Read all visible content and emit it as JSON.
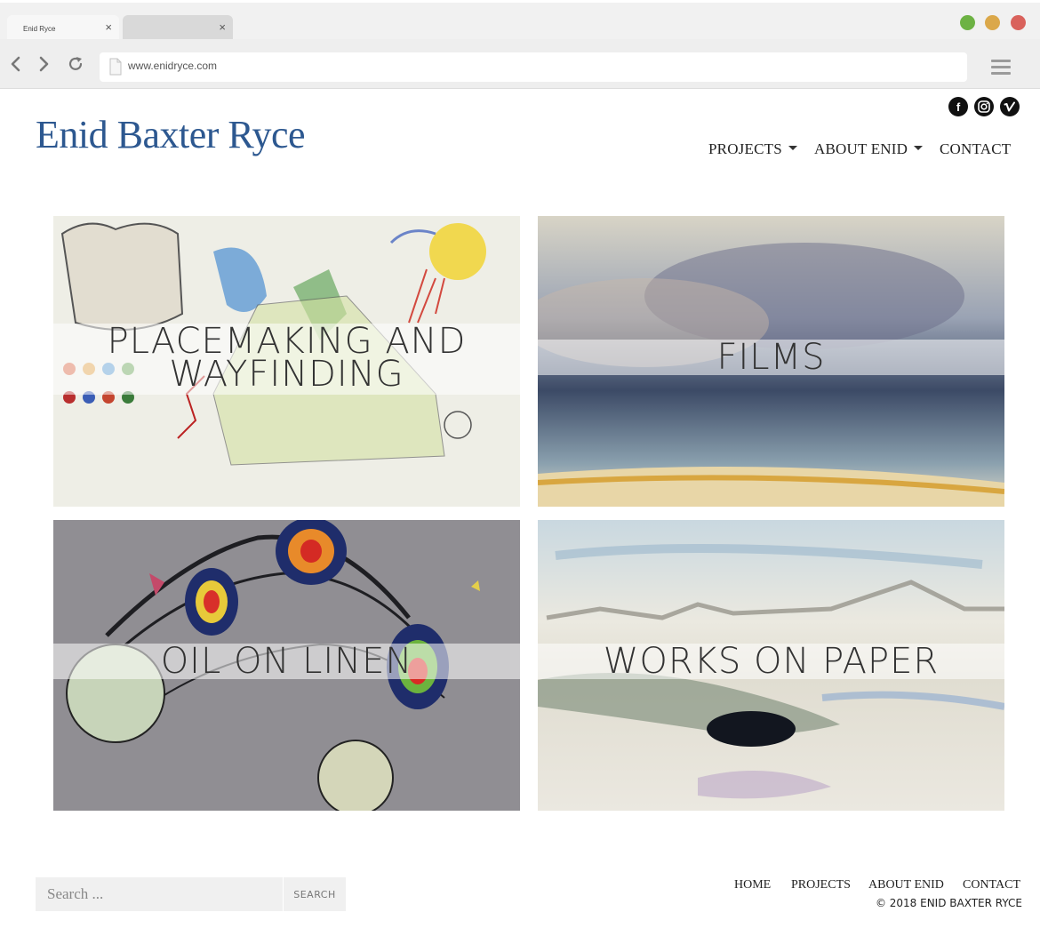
{
  "browser": {
    "tabs": [
      {
        "title": "Enid Ryce",
        "close": "×"
      },
      {
        "title": "",
        "close": "×"
      }
    ],
    "url": "www.enidryce.com",
    "window_controls": {
      "minimize": "#6db244",
      "maximize": "#dba84a",
      "close": "#d9625c"
    }
  },
  "site": {
    "title": "Enid Baxter Ryce",
    "title_color": "#2d5890",
    "social": [
      "facebook-icon",
      "instagram-icon",
      "vimeo-icon"
    ],
    "nav": [
      {
        "label": "PROJECTS",
        "dropdown": true
      },
      {
        "label": "ABOUT ENID",
        "dropdown": true
      },
      {
        "label": "CONTACT",
        "dropdown": false
      }
    ]
  },
  "tiles": [
    {
      "label_line1": "PLACEMAKING AND",
      "label_line2": "WAYFINDING"
    },
    {
      "label_line1": "FILMS"
    },
    {
      "label_line1": "OIL ON LINEN"
    },
    {
      "label_line1": "WORKS ON PAPER"
    }
  ],
  "footer": {
    "search_placeholder": "Search ...",
    "search_button": "SEARCH",
    "nav": [
      "HOME",
      "PROJECTS",
      "ABOUT ENID",
      "CONTACT"
    ],
    "copyright": "© 2018 ENID BAXTER RYCE"
  }
}
